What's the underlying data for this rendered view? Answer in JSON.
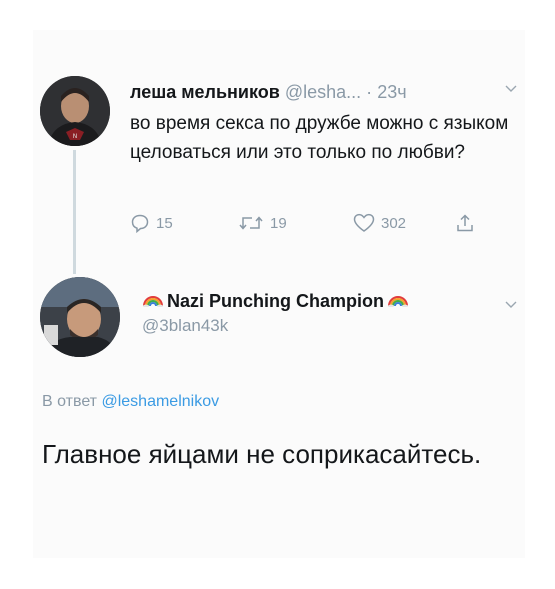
{
  "tweet1": {
    "author_name": "леша мельников",
    "handle": "@lesha...",
    "separator": "·",
    "time": "23ч",
    "text": "во время секса по дружбе можно с языком целоваться или это только по любви?",
    "reply_count": "15",
    "retweet_count": "19",
    "like_count": "302"
  },
  "tweet2": {
    "display_name": "Nazi Punching Champion",
    "handle": "@3blan43k",
    "reply_prefix": "В ответ",
    "reply_handle": "@leshamelnikov",
    "text": "Главное яйцами не соприкасайтесь."
  },
  "icons": {
    "reply": "reply-icon",
    "retweet": "retweet-icon",
    "like": "heart-icon",
    "share": "share-icon",
    "rainbow": "rainbow-icon",
    "menu": "chevron-down-icon"
  },
  "colors": {
    "link": "#3b9be3",
    "muted": "#8a99a6",
    "text": "#14171a"
  }
}
